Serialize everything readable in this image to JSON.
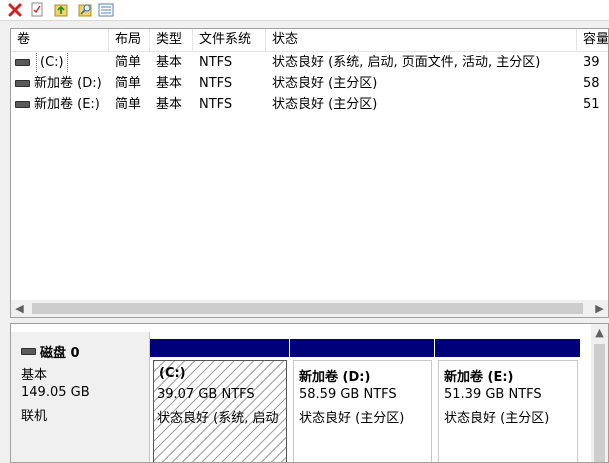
{
  "toolbar": {
    "icons": [
      "close-red-x-icon",
      "properties-check-icon",
      "folder-up-icon",
      "folder-search-icon",
      "list-view-icon"
    ]
  },
  "volume_list": {
    "columns": [
      "卷",
      "布局",
      "类型",
      "文件系统",
      "状态",
      "容量"
    ],
    "rows": [
      {
        "volume": "(C:)",
        "layout": "简单",
        "type": "基本",
        "fs": "NTFS",
        "status": "状态良好 (系统, 启动, 页面文件, 活动, 主分区)",
        "capacity": "39"
      },
      {
        "volume": "新加卷 (D:)",
        "layout": "简单",
        "type": "基本",
        "fs": "NTFS",
        "status": "状态良好 (主分区)",
        "capacity": "58"
      },
      {
        "volume": "新加卷 (E:)",
        "layout": "简单",
        "type": "基本",
        "fs": "NTFS",
        "status": "状态良好 (主分区)",
        "capacity": "51"
      }
    ]
  },
  "disk": {
    "name": "磁盘 0",
    "type": "基本",
    "size": "149.05 GB",
    "state": "联机",
    "partitions": [
      {
        "name": "(C:)",
        "size_fs": "39.07 GB NTFS",
        "status": "状态良好 (系统, 启动"
      },
      {
        "name": "新加卷  (D:)",
        "size_fs": "58.59 GB NTFS",
        "status": "状态良好 (主分区)"
      },
      {
        "name": "新加卷  (E:)",
        "size_fs": "51.39 GB NTFS",
        "status": "状态良好 (主分区)"
      }
    ]
  },
  "colors": {
    "partition_bar": "#00007b",
    "close_icon": "#d42020"
  }
}
